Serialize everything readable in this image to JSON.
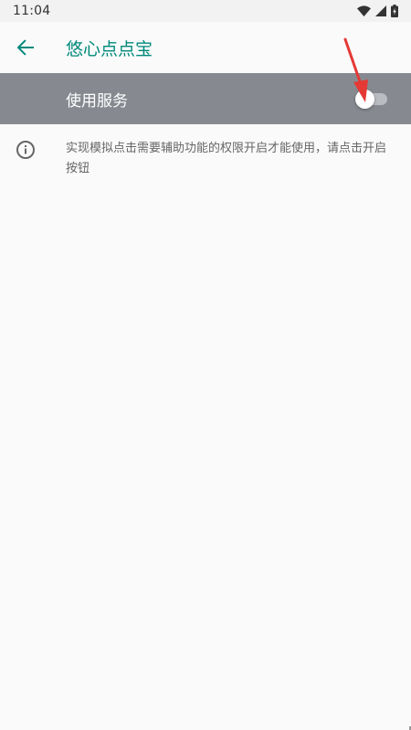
{
  "status_bar": {
    "time": "11:04",
    "icons": [
      "wifi-icon",
      "signal-icon",
      "battery-charging-icon"
    ]
  },
  "app_bar": {
    "back_icon": "arrow-back-icon",
    "title": "悠心点点宝"
  },
  "service_switch": {
    "label": "使用服务",
    "enabled": false
  },
  "info": {
    "icon": "info-icon",
    "text": "实现模拟点击需要辅助功能的权限开启才能使用，请点击开启按钮"
  },
  "colors": {
    "accent": "#00897b",
    "switch_row_bg": "#868a90",
    "annotation_arrow": "#e53935",
    "background": "#fafafa"
  }
}
